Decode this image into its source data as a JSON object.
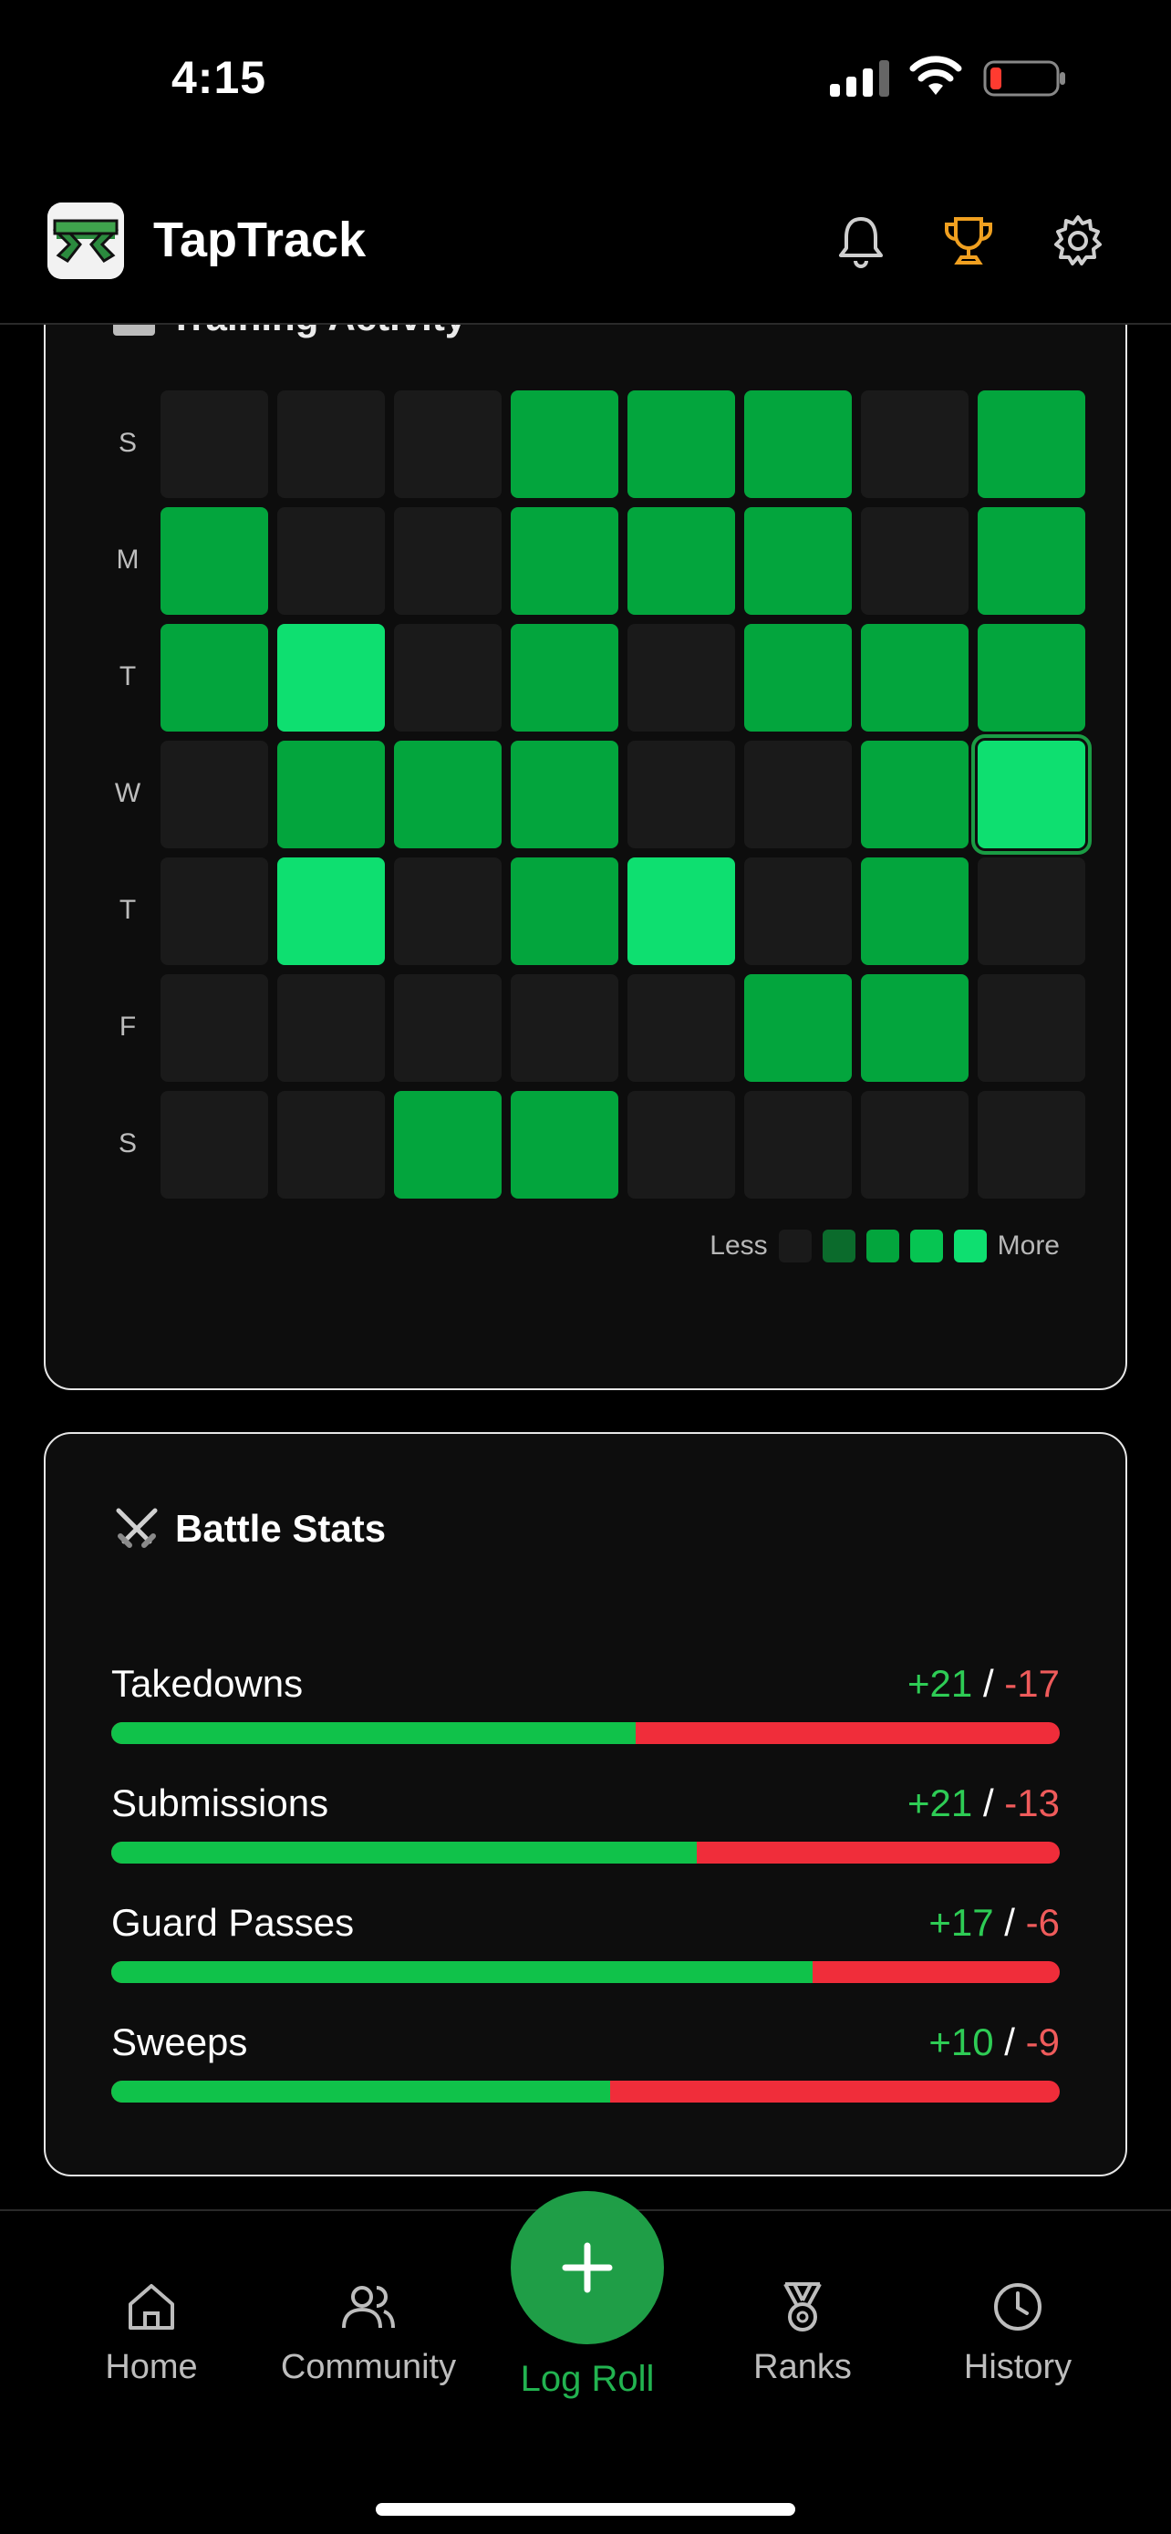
{
  "status_bar": {
    "time": "4:15"
  },
  "header": {
    "app_name": "TapTrack"
  },
  "training": {
    "title": "Training Activity",
    "day_labels": [
      "S",
      "M",
      "T",
      "W",
      "T",
      "F",
      "S"
    ],
    "grid": [
      [
        0,
        0,
        0,
        2,
        2,
        2,
        0,
        2
      ],
      [
        2,
        0,
        0,
        2,
        2,
        2,
        0,
        2
      ],
      [
        2,
        4,
        0,
        2,
        0,
        2,
        2,
        2
      ],
      [
        0,
        2,
        2,
        2,
        0,
        0,
        2,
        4
      ],
      [
        0,
        4,
        0,
        2,
        4,
        0,
        2,
        0
      ],
      [
        0,
        0,
        0,
        0,
        0,
        2,
        2,
        0
      ],
      [
        0,
        0,
        2,
        2,
        0,
        0,
        0,
        0
      ]
    ],
    "selected": [
      3,
      7
    ],
    "legend": {
      "less": "Less",
      "more": "More"
    }
  },
  "stats": {
    "title": "Battle Stats",
    "rows": [
      {
        "name": "Takedowns",
        "plus": "+21",
        "minus": "-17",
        "won": 21,
        "lost": 17
      },
      {
        "name": "Submissions",
        "plus": "+21",
        "minus": "-13",
        "won": 21,
        "lost": 13
      },
      {
        "name": "Guard Passes",
        "plus": "+17",
        "minus": "-6",
        "won": 17,
        "lost": 6
      },
      {
        "name": "Sweeps",
        "plus": "+10",
        "minus": "-9",
        "won": 10,
        "lost": 9
      }
    ]
  },
  "nav": {
    "home": "Home",
    "community": "Community",
    "log_roll": "Log Roll",
    "ranks": "Ranks",
    "history": "History"
  },
  "colors": {
    "accent": "#1f9e47",
    "win": "#10c24a",
    "loss": "#f02d3a",
    "trophy": "#f0a020"
  }
}
